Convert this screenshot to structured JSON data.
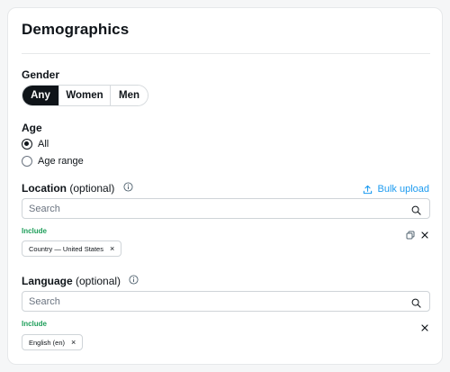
{
  "title": "Demographics",
  "gender": {
    "label": "Gender",
    "options": [
      "Any",
      "Women",
      "Men"
    ],
    "selected": "Any"
  },
  "age": {
    "label": "Age",
    "options": [
      "All",
      "Age range"
    ],
    "selected": "All"
  },
  "location": {
    "label": "Location",
    "optional": "(optional)",
    "bulk_upload": "Bulk upload",
    "search_placeholder": "Search",
    "include_label": "Include",
    "chips": [
      "Country — United States"
    ]
  },
  "language": {
    "label": "Language",
    "optional": "(optional)",
    "search_placeholder": "Search",
    "include_label": "Include",
    "chips": [
      "English (en)"
    ]
  },
  "icons": {
    "info": "info-icon",
    "search": "search-icon",
    "upload": "upload-icon",
    "copy": "copy-icon",
    "close": "close-icon"
  },
  "colors": {
    "accent_blue": "#1d9bf0",
    "include_green": "#1e9e5a",
    "active_segment": "#0f1419"
  }
}
